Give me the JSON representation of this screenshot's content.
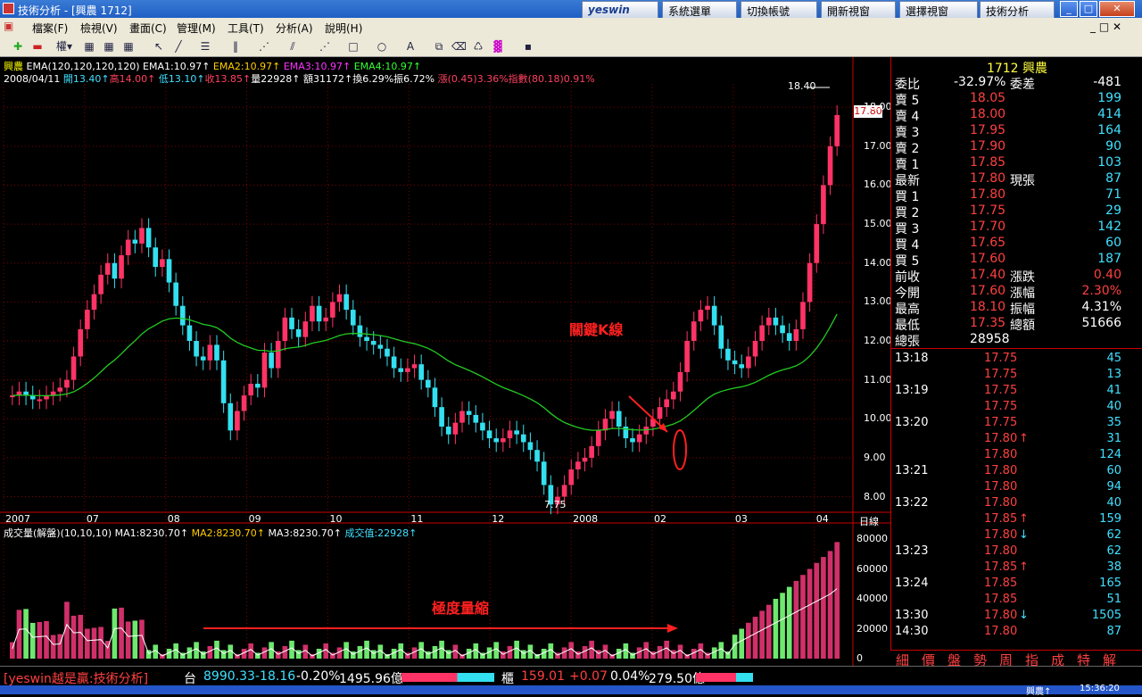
{
  "window": {
    "title": "技術分析 - [興農 1712]",
    "brand": "yeswin",
    "top_buttons": [
      "系統選單",
      "切換帳號",
      "開新視窗",
      "選擇視窗",
      "技術分析"
    ]
  },
  "menu": [
    "檔案(F)",
    "檢視(V)",
    "畫面(C)",
    "管理(M)",
    "工具(T)",
    "分析(A)",
    "說明(H)"
  ],
  "chart": {
    "ema_legend": {
      "name": "興農",
      "params": "EMA(120,120,120,120)",
      "ema1": "EMA1:10.97↑",
      "ema2": "EMA2:10.97↑",
      "ema3": "EMA3:10.97↑",
      "ema4": "EMA4:10.97↑"
    },
    "info_line": {
      "date": "2008/04/11",
      "open": "開13.40↑",
      "high": "高14.00↑",
      "low": "低13.10↑",
      "close": "收13.85↑",
      "vol": "量22928↑",
      "amt": "額31172↑",
      "turnover": "換6.29%",
      "amplitude": "振6.72%",
      "change": "漲(0.45)3.36%",
      "index": "指數(80.18)0.91%"
    },
    "max_label": "18.40",
    "min_label": "7.75",
    "last_price_tag": "17.80",
    "annotation_kline": "關鍵K線",
    "annotation_volume": "極度量縮",
    "period_label": "日線",
    "y_ticks": [
      "18.00",
      "17.00",
      "16.00",
      "15.00",
      "14.00",
      "13.00",
      "12.00",
      "11.00",
      "10.00",
      "9.00",
      "8.00"
    ],
    "x_ticks": [
      "2007",
      "07",
      "08",
      "09",
      "10",
      "11",
      "12",
      "2008",
      "02",
      "03",
      "04"
    ],
    "vol_legend": {
      "name": "成交量(解盤)(10,10,10)",
      "ma1": "MA1:8230.70↑",
      "ma2": "MA2:8230.70↑",
      "ma3": "MA3:8230.70↑",
      "cur": "成交值:22928↑"
    },
    "vol_ticks": [
      "80000",
      "60000",
      "40000",
      "20000",
      "0"
    ],
    "colors": {
      "up": "#ff3366",
      "down": "#33e0f0",
      "ema": "#22cc22",
      "grid": "#800000",
      "vol_up": "#d0306a",
      "vol_down": "#6ee86e"
    }
  },
  "chart_data": {
    "type": "candlestick",
    "price_range": [
      7.6,
      18.6
    ],
    "close": [
      10.6,
      10.7,
      10.6,
      10.5,
      10.5,
      10.6,
      10.7,
      10.8,
      11.0,
      11.6,
      12.3,
      12.8,
      13.2,
      13.7,
      14.0,
      13.6,
      14.2,
      14.6,
      14.5,
      14.9,
      14.4,
      13.9,
      14.1,
      13.5,
      12.9,
      12.4,
      12.0,
      11.6,
      11.5,
      11.9,
      11.5,
      10.4,
      9.7,
      10.2,
      10.6,
      10.9,
      10.8,
      11.7,
      11.3,
      12.0,
      12.6,
      12.3,
      12.1,
      12.5,
      12.9,
      12.5,
      12.6,
      13.0,
      13.2,
      12.8,
      12.4,
      12.1,
      12.0,
      11.9,
      11.8,
      11.6,
      11.3,
      11.2,
      11.3,
      11.4,
      11.0,
      10.8,
      10.3,
      9.8,
      9.6,
      9.9,
      10.2,
      10.1,
      9.9,
      9.7,
      9.5,
      9.4,
      9.5,
      9.7,
      9.6,
      9.4,
      9.2,
      8.9,
      8.3,
      7.8,
      8.0,
      8.3,
      8.7,
      8.9,
      9.0,
      9.3,
      9.7,
      10.0,
      10.2,
      9.8,
      9.5,
      9.4,
      9.6,
      9.8,
      10.0,
      10.3,
      10.5,
      10.7,
      11.2,
      12.0,
      12.5,
      12.8,
      12.9,
      12.4,
      11.8,
      11.5,
      11.4,
      11.3,
      11.6,
      12.0,
      12.4,
      12.6,
      12.4,
      12.2,
      12.0,
      12.3,
      13.0,
      14.0,
      15.0,
      16.0,
      17.0,
      17.8
    ]
  },
  "quote": {
    "header": "1712 興農",
    "ratio": {
      "label": "委比",
      "value": "-32.97%",
      "label2": "委差",
      "value2": "-481"
    },
    "asks": [
      {
        "label": "賣 5",
        "price": "18.05",
        "vol": "199"
      },
      {
        "label": "賣 4",
        "price": "18.00",
        "vol": "414"
      },
      {
        "label": "賣 3",
        "price": "17.95",
        "vol": "164"
      },
      {
        "label": "賣 2",
        "price": "17.90",
        "vol": "90"
      },
      {
        "label": "賣 1",
        "price": "17.85",
        "vol": "103"
      }
    ],
    "latest": {
      "label": "最新",
      "price": "17.80",
      "label2": "現張",
      "vol": "87"
    },
    "bids": [
      {
        "label": "買 1",
        "price": "17.80",
        "vol": "71"
      },
      {
        "label": "買 2",
        "price": "17.75",
        "vol": "29"
      },
      {
        "label": "買 3",
        "price": "17.70",
        "vol": "142"
      },
      {
        "label": "買 4",
        "price": "17.65",
        "vol": "60"
      },
      {
        "label": "買 5",
        "price": "17.60",
        "vol": "187"
      }
    ],
    "stats": [
      {
        "label": "前收",
        "v1": "17.40",
        "label2": "漲跌",
        "v2": "0.40"
      },
      {
        "label": "今開",
        "v1": "17.60",
        "label2": "漲幅",
        "v2": "2.30%"
      },
      {
        "label": "最高",
        "v1": "18.10",
        "label2": "振幅",
        "v2": "4.31%"
      },
      {
        "label": "最低",
        "v1": "17.35",
        "label2": "總額",
        "v2": "51666"
      },
      {
        "label": "總張",
        "v1": "28958",
        "label2": "",
        "v2": ""
      }
    ],
    "ticks": [
      {
        "time": "13:18",
        "price": "17.75",
        "arrow": "",
        "vol": "45"
      },
      {
        "time": "",
        "price": "17.75",
        "arrow": "",
        "vol": "13"
      },
      {
        "time": "13:19",
        "price": "17.75",
        "arrow": "",
        "vol": "41"
      },
      {
        "time": "",
        "price": "17.75",
        "arrow": "",
        "vol": "40"
      },
      {
        "time": "13:20",
        "price": "17.75",
        "arrow": "",
        "vol": "35"
      },
      {
        "time": "",
        "price": "17.80",
        "arrow": "↑",
        "vol": "31"
      },
      {
        "time": "",
        "price": "17.80",
        "arrow": "",
        "vol": "124"
      },
      {
        "time": "13:21",
        "price": "17.80",
        "arrow": "",
        "vol": "60"
      },
      {
        "time": "",
        "price": "17.80",
        "arrow": "",
        "vol": "94"
      },
      {
        "time": "13:22",
        "price": "17.80",
        "arrow": "",
        "vol": "40"
      },
      {
        "time": "",
        "price": "17.85",
        "arrow": "↑",
        "vol": "159"
      },
      {
        "time": "",
        "price": "17.80",
        "arrow": "↓",
        "vol": "62"
      },
      {
        "time": "13:23",
        "price": "17.80",
        "arrow": "",
        "vol": "62"
      },
      {
        "time": "",
        "price": "17.85",
        "arrow": "↑",
        "vol": "38"
      },
      {
        "time": "13:24",
        "price": "17.85",
        "arrow": "",
        "vol": "165"
      },
      {
        "time": "",
        "price": "17.85",
        "arrow": "",
        "vol": "51"
      },
      {
        "time": "13:30",
        "price": "17.80",
        "arrow": "↓",
        "vol": "1505"
      },
      {
        "time": "14:30",
        "price": "17.80",
        "arrow": "",
        "vol": "87"
      }
    ],
    "tabs": [
      "細",
      "價",
      "盤",
      "勢",
      "周",
      "指",
      "成",
      "特",
      "解"
    ]
  },
  "status": {
    "slogan": "[yeswin越是贏:技術分析]",
    "tw_label": "台",
    "tw_index": "8990.33",
    "tw_change": "-18.16",
    "tw_pct": "-0.20%",
    "tw_amt": "1495.96億",
    "otc_label": "櫃",
    "otc_index": "159.01",
    "otc_change": "+0.07",
    "otc_pct": "0.04%",
    "otc_amt": "279.50億",
    "taskbar_item": "興農↑",
    "clock": "15:36:20"
  }
}
